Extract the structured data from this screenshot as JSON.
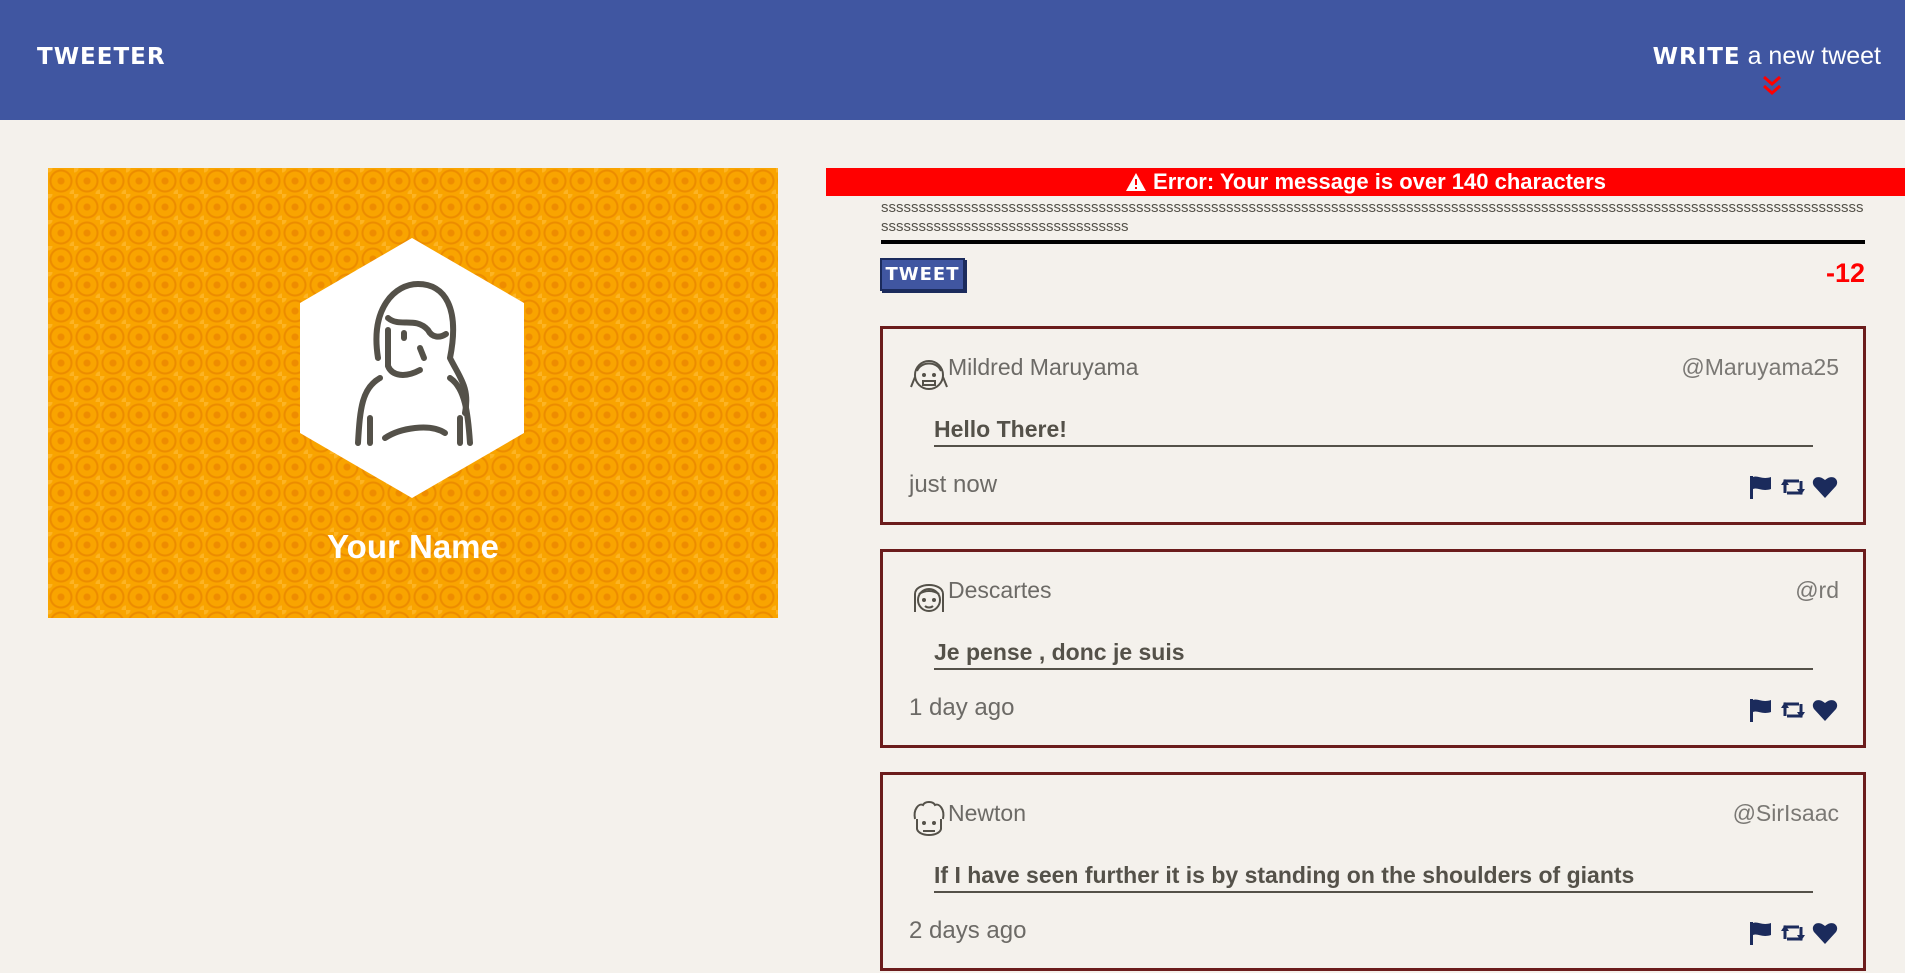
{
  "nav": {
    "logo": "TWEETER",
    "write_bold": "WRITE",
    "write_rest": " a new tweet",
    "chevron_icon": "double-chevron-down-icon",
    "chevron_color": "#ff0000"
  },
  "profile": {
    "name": "Your Name",
    "avatar_icon": "woman-avatar-icon"
  },
  "compose": {
    "error": "Error: Your message is over 140 characters",
    "text": "ssssssssssssssssssssssssssssssssssssssssssssssssssssssssssssssssssssssssssssssssssssssssssssssssssssssssssssssssssssssssssssssssssssssssssssssssssssssssssssssssssss",
    "button": "TWEET",
    "counter": "-12"
  },
  "tweets": [
    {
      "name": "Mildred Maruyama",
      "handle": "@Maruyama25",
      "content": "Hello There!",
      "time": "just now",
      "avatar_icon": "girl-pigtails-avatar-icon"
    },
    {
      "name": "Descartes",
      "handle": "@rd",
      "content": "Je pense , donc je suis",
      "time": "1 day ago",
      "avatar_icon": "long-hair-avatar-icon"
    },
    {
      "name": "Newton",
      "handle": "@SirIsaac",
      "content": "If I have seen further it is by standing on the shoulders of giants",
      "time": "2 days ago",
      "avatar_icon": "curly-hair-avatar-icon"
    }
  ],
  "colors": {
    "nav": "#4056a1",
    "background": "#f4f1ec",
    "profile": "#f9a400",
    "error": "#ff0000",
    "tweet_border": "#6b1c1c",
    "icon": "#1b2b5c"
  }
}
